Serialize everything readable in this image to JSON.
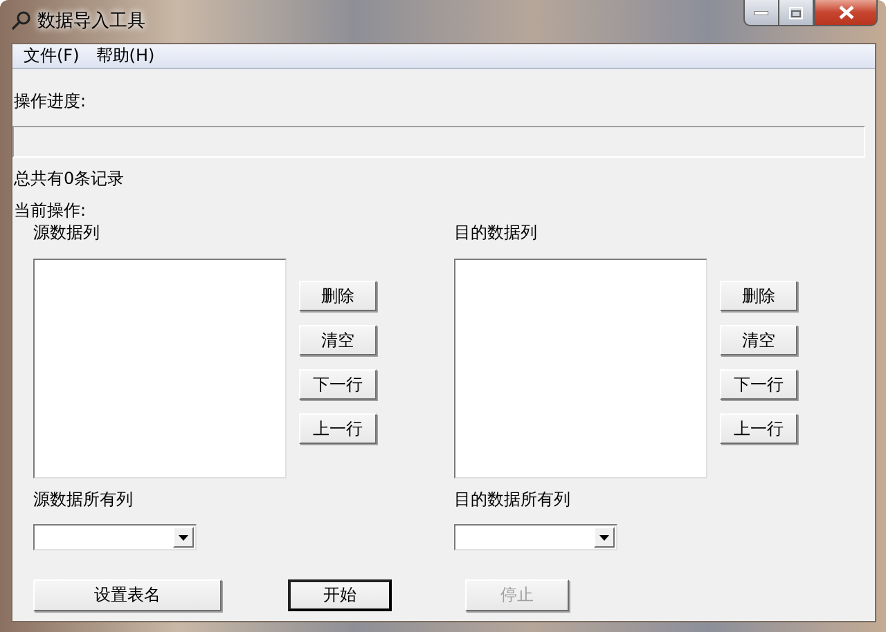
{
  "window": {
    "title": "数据导入工具"
  },
  "menu": [
    {
      "label": "文件(F)"
    },
    {
      "label": "帮助(H)"
    }
  ],
  "progress_label": "操作进度:",
  "progress": {
    "level": 0
  },
  "record_count": "总共有0条记录",
  "current_operation": "当前操作:",
  "panels": [
    {
      "list_label": "源数据列",
      "buttons": [
        {
          "label": "删除",
          "disabled": false
        },
        {
          "label": "清空",
          "disabled": false
        },
        {
          "label": "下一行",
          "disabled": false
        },
        {
          "label": "上一行",
          "disabled": false
        }
      ],
      "all_columns_label": "源数据所有列"
    },
    {
      "list_label": "目的数据列",
      "buttons": [
        {
          "label": "删除",
          "disabled": false
        },
        {
          "label": "清空",
          "disabled": false
        },
        {
          "label": "下一行",
          "disabled": false
        },
        {
          "label": "上一行",
          "disabled": false
        }
      ],
      "all_columns_label": "目的数据所有列"
    }
  ],
  "actions": [
    {
      "label": "设置表名",
      "default": false,
      "disabled": false
    },
    {
      "label": "开始",
      "default": true,
      "disabled": false
    },
    {
      "label": "停止",
      "default": false,
      "disabled": true
    }
  ]
}
